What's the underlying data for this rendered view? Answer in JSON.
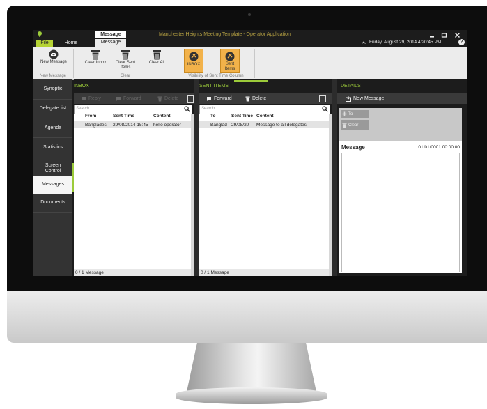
{
  "app": {
    "title": "Manchester Heights Meeting Template - Operator Application",
    "context_tab": "Message",
    "datetime": "Friday, August 29, 2014 4:20:45 PM",
    "tabs": [
      "File",
      "Home",
      "Message"
    ]
  },
  "ribbon": {
    "new_message": "New Message",
    "clear_inbox": "Clear Inbox",
    "clear_sent": "Clear Sent Items",
    "clear_all": "Clear All",
    "inbox": "INBOX",
    "sent_items": "Sent Items",
    "group_new": "New Message",
    "group_clear": "Clear",
    "group_visibility": "Visibility of Sent Time Column"
  },
  "sidebar": {
    "items": [
      "Synoptic",
      "Delegate list",
      "Agenda",
      "Statistics",
      "Screen Control",
      "Messages",
      "Documents"
    ],
    "active": "Messages"
  },
  "inbox": {
    "title": "INBOX",
    "reply": "Reply",
    "forward": "Forward",
    "delete": "Delete",
    "search_placeholder": "Search",
    "columns": [
      "From",
      "Sent Time",
      "Content"
    ],
    "rows": [
      {
        "from": "Banglades",
        "time": "29/08/2014 15:45",
        "content": "hello operator"
      }
    ],
    "footer": "0 / 1 Message"
  },
  "sent": {
    "title": "SENT ITEMS",
    "forward": "Forward",
    "delete": "Delete",
    "search_placeholder": "Search",
    "columns": [
      "To",
      "Sent Time",
      "Content"
    ],
    "rows": [
      {
        "to": "Banglad",
        "time": "29/08/20",
        "content": "Message to all delegates"
      }
    ],
    "footer": "0 / 1 Message"
  },
  "details": {
    "title": "DETAILS",
    "new_message": "New Message",
    "to": "To",
    "clear": "Clear",
    "message_label": "Message",
    "message_date": "01/01/0001 00:00:00"
  },
  "colors": {
    "accent": "#9ccb3a",
    "toggle_active": "#f2b24a",
    "file_tab": "#b5d334"
  }
}
